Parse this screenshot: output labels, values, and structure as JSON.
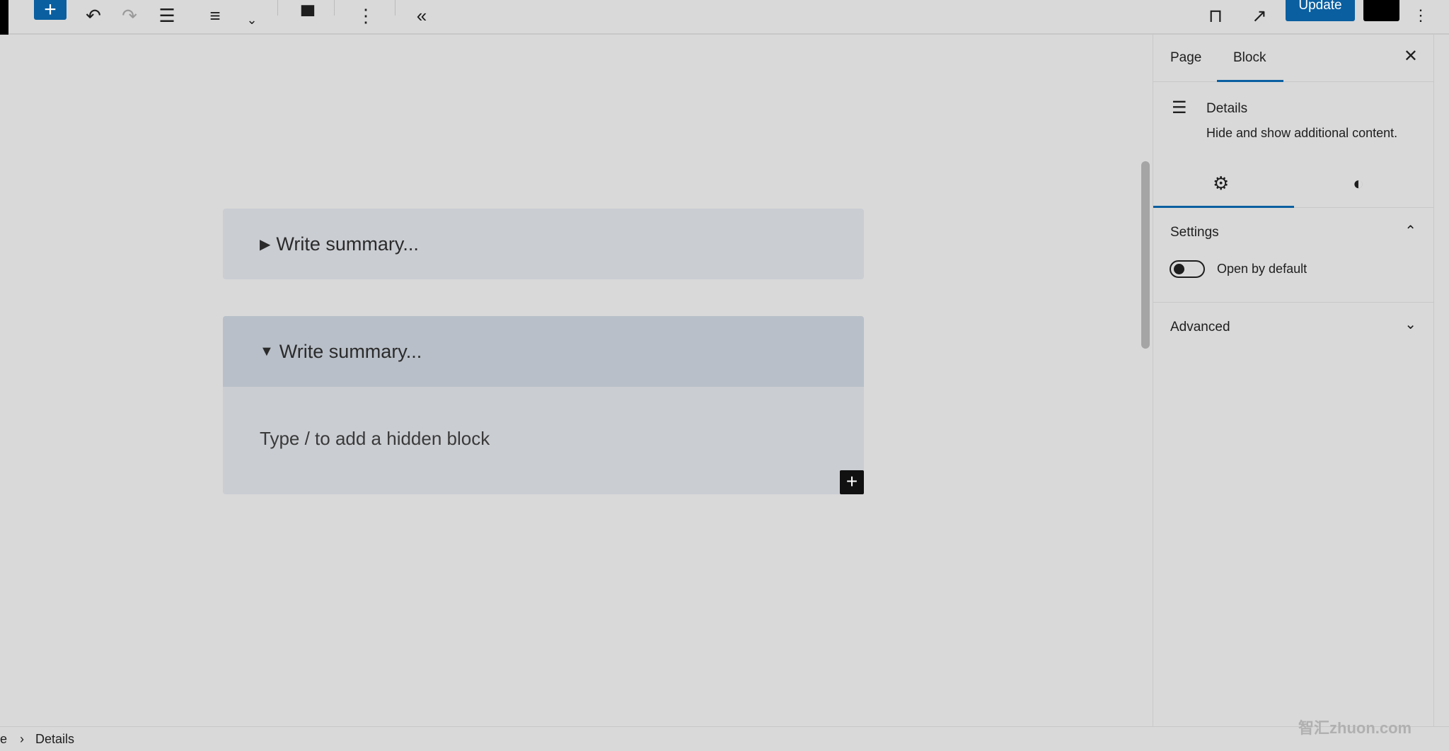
{
  "toolbar": {
    "update_label": "Update"
  },
  "editor": {
    "blocks": [
      {
        "summary": "Write summary...",
        "open": false,
        "triangle": "▶"
      },
      {
        "summary": "Write summary...",
        "open": true,
        "triangle": "▼",
        "placeholder": "Type / to add a hidden block"
      }
    ]
  },
  "sidebar": {
    "tabs": [
      {
        "label": "Page"
      },
      {
        "label": "Block",
        "active": true
      }
    ],
    "block_title": "Details",
    "block_description": "Hide and show additional content.",
    "settings": {
      "title": "Settings",
      "toggle_label": "Open by default",
      "toggle_on": false
    },
    "advanced": {
      "title": "Advanced"
    }
  },
  "footer": {
    "breadcrumb": [
      "e",
      "Details"
    ]
  },
  "watermark": "智汇zhuon.com",
  "colors": {
    "accent": "#0a5fa0"
  }
}
